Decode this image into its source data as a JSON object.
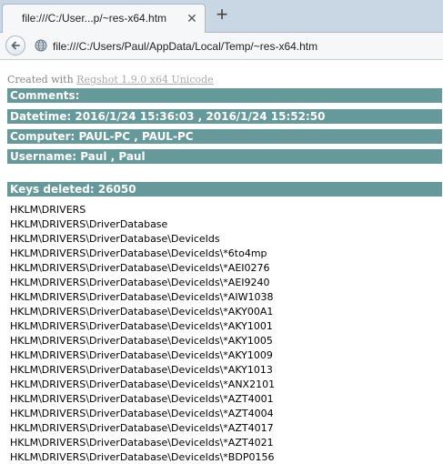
{
  "browser": {
    "tab_title": "file:///C:/User...p/~res-x64.htm",
    "tab_close": "✕",
    "new_tab": "+",
    "url": "file:///C:/Users/Paul/AppData/Local/Temp/~res-x64.htm"
  },
  "report": {
    "created_prefix": "Created with",
    "created_link": "Regshot 1.9.0 x64 Unicode",
    "comments": "Comments:",
    "datetime": "Datetime: 2016/1/24 15:36:03 , 2016/1/24 15:52:50",
    "computer": "Computer: PAUL-PC , PAUL-PC",
    "username": "Username: Paul , Paul",
    "keys_deleted": "Keys deleted: 26050",
    "keys": [
      "HKLM\\DRIVERS",
      "HKLM\\DRIVERS\\DriverDatabase",
      "HKLM\\DRIVERS\\DriverDatabase\\DeviceIds",
      "HKLM\\DRIVERS\\DriverDatabase\\DeviceIds\\*6to4mp",
      "HKLM\\DRIVERS\\DriverDatabase\\DeviceIds\\*AEI0276",
      "HKLM\\DRIVERS\\DriverDatabase\\DeviceIds\\*AEI9240",
      "HKLM\\DRIVERS\\DriverDatabase\\DeviceIds\\*AIW1038",
      "HKLM\\DRIVERS\\DriverDatabase\\DeviceIds\\*AKY00A1",
      "HKLM\\DRIVERS\\DriverDatabase\\DeviceIds\\*AKY1001",
      "HKLM\\DRIVERS\\DriverDatabase\\DeviceIds\\*AKY1005",
      "HKLM\\DRIVERS\\DriverDatabase\\DeviceIds\\*AKY1009",
      "HKLM\\DRIVERS\\DriverDatabase\\DeviceIds\\*AKY1013",
      "HKLM\\DRIVERS\\DriverDatabase\\DeviceIds\\*ANX2101",
      "HKLM\\DRIVERS\\DriverDatabase\\DeviceIds\\*AZT4001",
      "HKLM\\DRIVERS\\DriverDatabase\\DeviceIds\\*AZT4004",
      "HKLM\\DRIVERS\\DriverDatabase\\DeviceIds\\*AZT4017",
      "HKLM\\DRIVERS\\DriverDatabase\\DeviceIds\\*AZT4021",
      "HKLM\\DRIVERS\\DriverDatabase\\DeviceIds\\*BDP0156"
    ]
  },
  "colors": {
    "section_bar": "#669999",
    "section_text": "#ffffff",
    "link": "#aaaaaa"
  },
  "icons": {
    "back": "back-arrow-icon",
    "page": "globe-icon",
    "close": "close-icon",
    "new_tab": "plus-icon"
  }
}
